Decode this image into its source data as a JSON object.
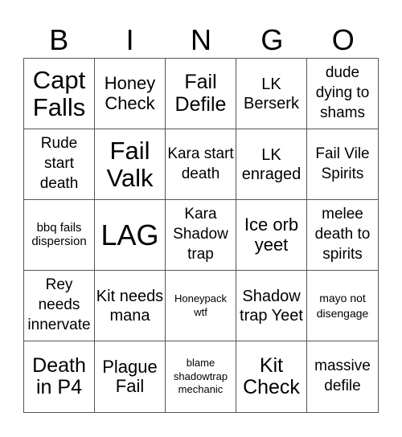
{
  "header": {
    "letters": [
      "B",
      "I",
      "N",
      "G",
      "O"
    ]
  },
  "cells": [
    "Capt Falls",
    "Honey Check",
    "Fail Defile",
    "LK Berserk",
    "dude dying to shams",
    "Rude start death",
    "Fail Valk",
    "Kara start death",
    "LK enraged",
    "Fail Vile Spirits",
    "bbq fails dispersion",
    "LAG",
    "Kara Shadow trap",
    "Ice orb yeet",
    "melee death to spirits",
    "Rey needs innervate",
    "Kit needs mana",
    "Honeypack wtf",
    "Shadow trap Yeet",
    "mayo not disengage",
    "Death in P4",
    "Plague Fail",
    "blame shadowtrap mechanic",
    "Kit Check",
    "massive defile"
  ]
}
